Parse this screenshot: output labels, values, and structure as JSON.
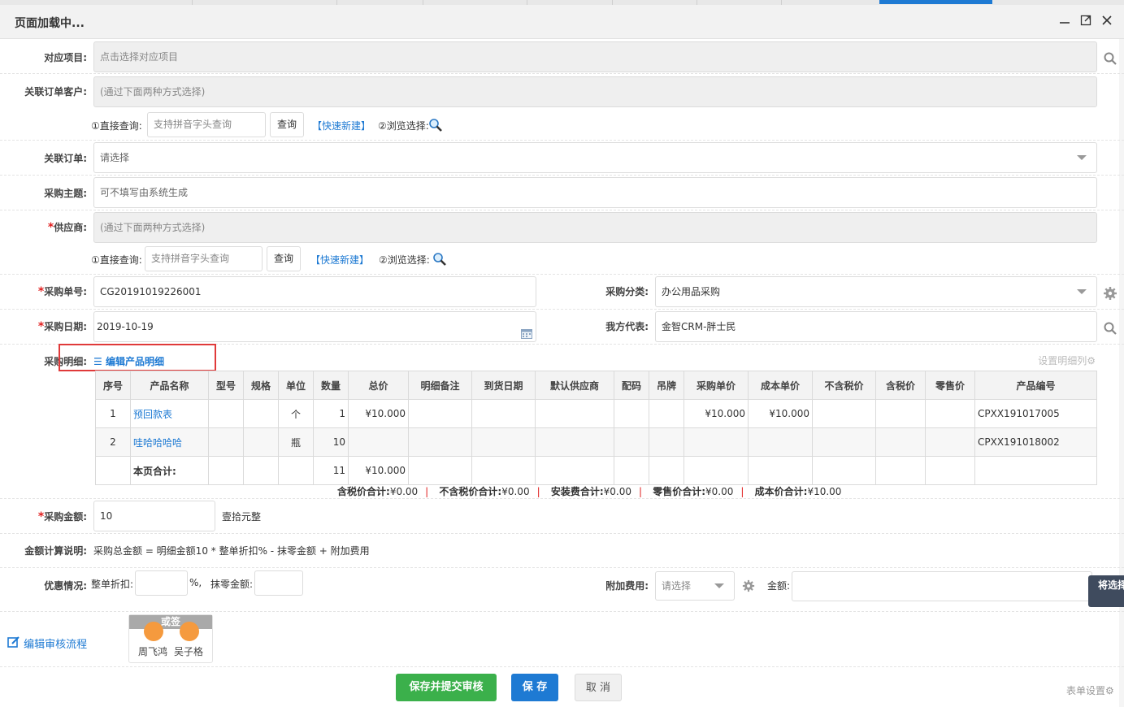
{
  "window": {
    "title": "页面加载中..."
  },
  "form": {
    "project": {
      "label": "对应项目:",
      "placeholder": "点击选择对应项目"
    },
    "customer": {
      "label": "关联订单客户:",
      "placeholder": "(通过下面两种方式选择)"
    },
    "customer_search": {
      "direct_label": "①直接查询:",
      "input_placeholder": "支持拼音字头查询",
      "query_btn": "查询",
      "quick_new": "【快速新建】",
      "browse_label": "②浏览选择:"
    },
    "order": {
      "label": "关联订单:",
      "placeholder": "请选择"
    },
    "subject": {
      "label": "采购主题:",
      "placeholder": "可不填写由系统生成"
    },
    "supplier": {
      "label": "供应商:",
      "placeholder": "(通过下面两种方式选择)"
    },
    "supplier_search": {
      "direct_label": "①直接查询:",
      "input_placeholder": "支持拼音字头查询",
      "query_btn": "查询",
      "quick_new": "【快速新建】",
      "browse_label": "②浏览选择:"
    },
    "po_number": {
      "label": "采购单号:",
      "value": "CG20191019226001"
    },
    "category": {
      "label": "采购分类:",
      "value": "办公用品采购"
    },
    "po_date": {
      "label": "采购日期:",
      "value": "2019-10-19"
    },
    "representative": {
      "label": "我方代表:",
      "value": "金智CRM-胖士民"
    },
    "detail": {
      "label": "采购明细:",
      "edit_link": "编辑产品明细",
      "settings": "设置明细列"
    },
    "amount": {
      "label": "采购金额:",
      "value": "10",
      "capital": "壹拾元整"
    },
    "calc": {
      "label": "金额计算说明:",
      "text": "采购总金额 = 明细金额10 * 整单折扣% - 抹零金额 + 附加费用"
    },
    "discount": {
      "label": "优惠情况:",
      "discount_label": "整单折扣:",
      "percent": "%,",
      "round_label": "抹零金额:",
      "extra_label": "附加费用:",
      "extra_placeholder": "请选择",
      "amount_label": "金额:",
      "side_btn": "将选择"
    }
  },
  "table": {
    "headers": [
      "序号",
      "产品名称",
      "型号",
      "规格",
      "单位",
      "数量",
      "总价",
      "明细备注",
      "到货日期",
      "默认供应商",
      "配码",
      "吊牌",
      "采购单价",
      "成本单价",
      "不含税价",
      "含税价",
      "零售价",
      "产品编号"
    ],
    "rows": [
      {
        "no": "1",
        "name": "预回款表",
        "unit": "个",
        "qty": "1",
        "total": "¥10.000",
        "price": "¥10.000",
        "cost": "¥10.000",
        "code": "CPXX191017005"
      },
      {
        "no": "2",
        "name": "哇哈哈哈哈",
        "unit": "瓶",
        "qty": "10",
        "total": "",
        "price": "",
        "cost": "",
        "code": "CPXX191018002"
      }
    ],
    "total_row": {
      "label": "本页合计:",
      "qty": "11",
      "total": "¥10.000"
    }
  },
  "summary": {
    "tax_incl_label": "含税价合计:",
    "tax_incl": "¥0.00",
    "tax_excl_label": "不含税价合计:",
    "tax_excl": "¥0.00",
    "install_label": "安装费合计:",
    "install": "¥0.00",
    "retail_label": "零售价合计:",
    "retail": "¥0.00",
    "cost_label": "成本价合计:",
    "cost": "¥10.00"
  },
  "audit": {
    "edit_link": "编辑审核流程",
    "group_title": "或签",
    "approvers": [
      "周飞鸿",
      "吴子格"
    ]
  },
  "actions": {
    "save_submit": "保存并提交审核",
    "save": "保 存",
    "cancel": "取 消",
    "form_settings": "表单设置"
  },
  "colors": {
    "accent": "#1e7ad3",
    "success": "#3bb04b",
    "required": "#e02020",
    "approver_dot": "#f59a3e"
  }
}
